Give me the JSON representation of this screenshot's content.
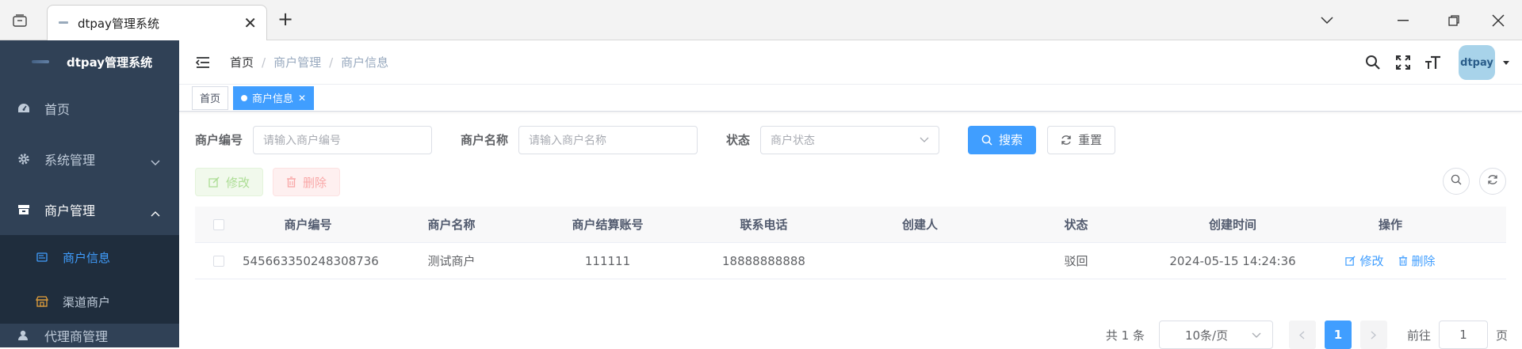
{
  "browser": {
    "tab_title": "dtpay管理系统"
  },
  "sidebar": {
    "logo_text": "dtpay管理系统",
    "items": [
      {
        "label": "首页",
        "icon": "dashboard-icon"
      },
      {
        "label": "系统管理",
        "icon": "gear-icon"
      },
      {
        "label": "商户管理",
        "icon": "store-icon"
      }
    ],
    "sub_items": [
      {
        "label": "商户信息",
        "icon": "id-card-icon"
      },
      {
        "label": "渠道商户",
        "icon": "shop-icon"
      }
    ],
    "cut_item": "代理商管理"
  },
  "navbar": {
    "breadcrumb": [
      "首页",
      "商户管理",
      "商户信息"
    ],
    "avatar_text": "dtpay"
  },
  "tags": {
    "home": "首页",
    "active": "商户信息"
  },
  "search": {
    "merchant_no_label": "商户编号",
    "merchant_no_placeholder": "请输入商户编号",
    "merchant_name_label": "商户名称",
    "merchant_name_placeholder": "请输入商户名称",
    "status_label": "状态",
    "status_placeholder": "商户状态",
    "search_btn": "搜索",
    "reset_btn": "重置"
  },
  "toolbar": {
    "edit_btn": "修改",
    "delete_btn": "删除"
  },
  "table": {
    "headers": [
      "商户编号",
      "商户名称",
      "商户结算账号",
      "联系电话",
      "创建人",
      "状态",
      "创建时间",
      "操作"
    ],
    "rows": [
      {
        "merchant_no": "545663350248308736",
        "merchant_name": "测试商户",
        "settle_account": "111111",
        "phone": "18888888888",
        "creator": "",
        "status": "驳回",
        "created_at": "2024-05-15 14:24:36",
        "edit": "修改",
        "delete": "删除"
      }
    ]
  },
  "pager": {
    "total": "共 1 条",
    "page_size": "10条/页",
    "current": "1",
    "goto_label": "前往",
    "goto_value": "1",
    "page_suffix": "页"
  },
  "colors": {
    "primary": "#409eff",
    "sidebar_bg": "#304156",
    "submenu_bg": "#1f2d3d"
  }
}
